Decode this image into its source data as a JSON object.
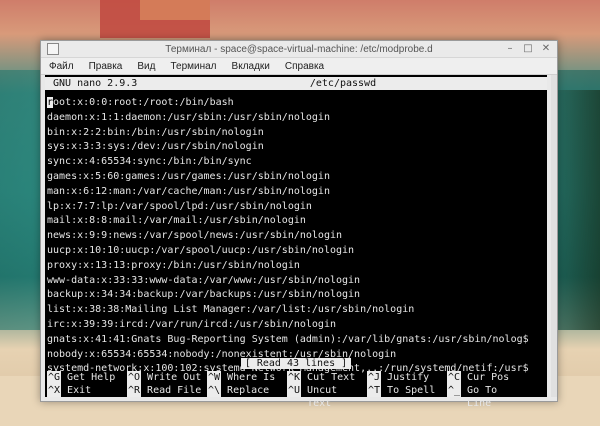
{
  "window": {
    "title": "Терминал - space@space-virtual-machine: /etc/modprobe.d",
    "controls": [
      "–",
      "□",
      "✕"
    ]
  },
  "menu": [
    "Файл",
    "Правка",
    "Вид",
    "Терминал",
    "Вкладки",
    "Справка"
  ],
  "nano": {
    "version": "GNU nano 2.9.3",
    "filename": "/etc/passwd",
    "status": "[ Read 43 lines ]",
    "lines": [
      "root:x:0:0:root:/root:/bin/bash",
      "daemon:x:1:1:daemon:/usr/sbin:/usr/sbin/nologin",
      "bin:x:2:2:bin:/bin:/usr/sbin/nologin",
      "sys:x:3:3:sys:/dev:/usr/sbin/nologin",
      "sync:x:4:65534:sync:/bin:/bin/sync",
      "games:x:5:60:games:/usr/games:/usr/sbin/nologin",
      "man:x:6:12:man:/var/cache/man:/usr/sbin/nologin",
      "lp:x:7:7:lp:/var/spool/lpd:/usr/sbin/nologin",
      "mail:x:8:8:mail:/var/mail:/usr/sbin/nologin",
      "news:x:9:9:news:/var/spool/news:/usr/sbin/nologin",
      "uucp:x:10:10:uucp:/var/spool/uucp:/usr/sbin/nologin",
      "proxy:x:13:13:proxy:/bin:/usr/sbin/nologin",
      "www-data:x:33:33:www-data:/var/www:/usr/sbin/nologin",
      "backup:x:34:34:backup:/var/backups:/usr/sbin/nologin",
      "list:x:38:38:Mailing List Manager:/var/list:/usr/sbin/nologin",
      "irc:x:39:39:ircd:/var/run/ircd:/usr/sbin/nologin",
      "gnats:x:41:41:Gnats Bug-Reporting System (admin):/var/lib/gnats:/usr/sbin/nolog$",
      "nobody:x:65534:65534:nobody:/nonexistent:/usr/sbin/nologin",
      "systemd-network:x:100:102:systemd Network Management,,,:/run/systemd/netif:/usr$"
    ],
    "shortcuts_row1": [
      {
        "key": "^G",
        "label": "Get Help"
      },
      {
        "key": "^O",
        "label": "Write Out"
      },
      {
        "key": "^W",
        "label": "Where Is"
      },
      {
        "key": "^K",
        "label": "Cut Text"
      },
      {
        "key": "^J",
        "label": "Justify"
      },
      {
        "key": "^C",
        "label": "Cur Pos"
      }
    ],
    "shortcuts_row2": [
      {
        "key": "^X",
        "label": "Exit"
      },
      {
        "key": "^R",
        "label": "Read File"
      },
      {
        "key": "^\\",
        "label": "Replace"
      },
      {
        "key": "^U",
        "label": "Uncut Text"
      },
      {
        "key": "^T",
        "label": "To Spell"
      },
      {
        "key": "^_",
        "label": "Go To Line"
      }
    ]
  }
}
